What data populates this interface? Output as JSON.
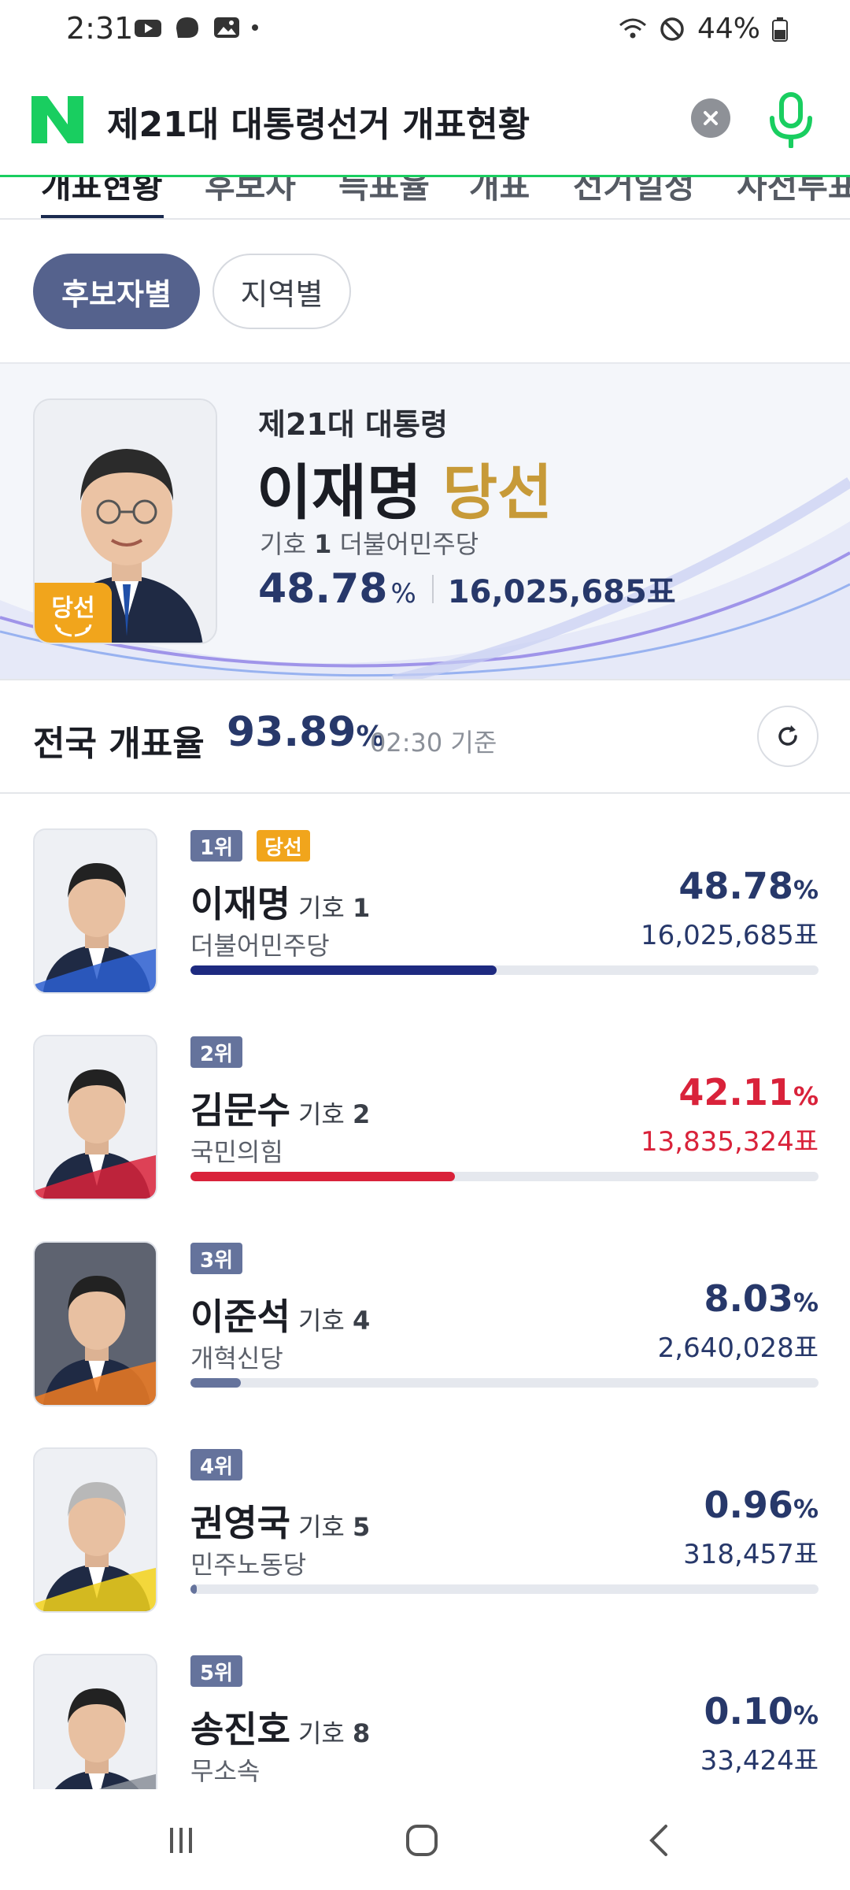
{
  "status_bar": {
    "time": "2:31",
    "battery": "44%"
  },
  "search": {
    "query": "제21대 대통령선거 개표현황"
  },
  "tabs": [
    "개표현황",
    "후보자",
    "득표율",
    "개표",
    "선거일정",
    "사전투표"
  ],
  "filters": {
    "candidate": "후보자별",
    "region": "지역별"
  },
  "winner": {
    "subtitle": "제21대 대통령",
    "name": "이재명",
    "status": "당선",
    "number_label": "기호",
    "number": "1",
    "party": "더불어민주당",
    "percent": "48.78",
    "percent_unit": "%",
    "votes": "16,025,685표",
    "photo_badge": "당선"
  },
  "count": {
    "label": "전국 개표율",
    "value": "93.89",
    "unit": "%",
    "time": "02:30 기준"
  },
  "candidates": [
    {
      "rank": "1위",
      "won": "당선",
      "name": "이재명",
      "number_label": "기호",
      "number": "1",
      "party": "더불어민주당",
      "percent": "48.78",
      "unit": "%",
      "votes": "16,025,685표",
      "share": 0.4878,
      "color": "#1e2a80",
      "photo_accent": "#2d5fd0"
    },
    {
      "rank": "2위",
      "name": "김문수",
      "number_label": "기호",
      "number": "2",
      "party": "국민의힘",
      "percent": "42.11",
      "unit": "%",
      "votes": "13,835,324표",
      "share": 0.4211,
      "color": "#d9223a",
      "photo_accent": "#d9223a"
    },
    {
      "rank": "3위",
      "name": "이준석",
      "number_label": "기호",
      "number": "4",
      "party": "개혁신당",
      "percent": "8.03",
      "unit": "%",
      "votes": "2,640,028표",
      "share": 0.0803,
      "color": "#65739c",
      "photo_accent": "#f07b22"
    },
    {
      "rank": "4위",
      "name": "권영국",
      "number_label": "기호",
      "number": "5",
      "party": "민주노동당",
      "percent": "0.96",
      "unit": "%",
      "votes": "318,457표",
      "share": 0.0096,
      "color": "#65739c",
      "photo_accent": "#f3d21a"
    },
    {
      "rank": "5위",
      "name": "송진호",
      "number_label": "기호",
      "number": "8",
      "party": "무소속",
      "percent": "0.10",
      "unit": "%",
      "votes": "33,424표",
      "share": 0.001,
      "color": "#65739c",
      "photo_accent": "#8a8f99"
    }
  ],
  "colors": {
    "naver_green": "#19ce60",
    "navy": "#27386a",
    "gold": "#c79a38",
    "red": "#d9223a"
  }
}
